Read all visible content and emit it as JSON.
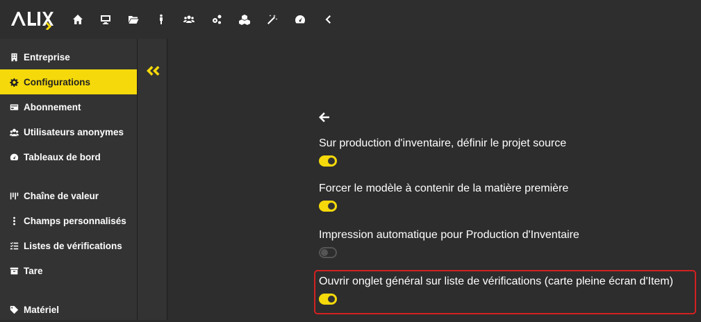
{
  "app": {
    "logo_text": "ALIX",
    "accent_color": "#f5d90a",
    "highlight_color": "#d42020"
  },
  "topnav": {
    "icons": [
      "home-icon",
      "desktop-icon",
      "folder-icon",
      "person-icon",
      "users-icon",
      "cogs-icon",
      "cubes-icon",
      "magic-wand-icon",
      "dashboard-gauge-icon",
      "chevron-left-icon"
    ]
  },
  "sidebar": {
    "items": [
      {
        "label": "Entreprise",
        "icon": "building-icon",
        "active": false
      },
      {
        "label": "Configurations",
        "icon": "gear-icon",
        "active": true
      },
      {
        "label": "Abonnement",
        "icon": "credit-card-icon",
        "active": false
      },
      {
        "label": "Utilisateurs anonymes",
        "icon": "user-secret-icon",
        "active": false
      },
      {
        "label": "Tableaux de bord",
        "icon": "gauge-icon",
        "active": false
      },
      {
        "label": "Chaîne de valeur",
        "icon": "value-chain-icon",
        "active": false
      },
      {
        "label": "Champs personnalisés",
        "icon": "vertical-ellipsis-icon",
        "active": false
      },
      {
        "label": "Listes de vérifications",
        "icon": "checklist-icon",
        "active": false
      },
      {
        "label": "Tare",
        "icon": "box-icon",
        "active": false
      },
      {
        "label": "Matériel",
        "icon": "tag-icon",
        "active": false
      }
    ]
  },
  "main": {
    "settings": [
      {
        "label": "Sur production d'inventaire, définir le projet source",
        "enabled": true
      },
      {
        "label": "Forcer le modèle à contenir de la matière première",
        "enabled": true
      },
      {
        "label": "Impression automatique pour Production d'Inventaire",
        "enabled": false
      },
      {
        "label": "Ouvrir onglet général sur liste de vérifications (carte pleine écran d'Item)",
        "enabled": true,
        "highlighted": true
      }
    ]
  }
}
